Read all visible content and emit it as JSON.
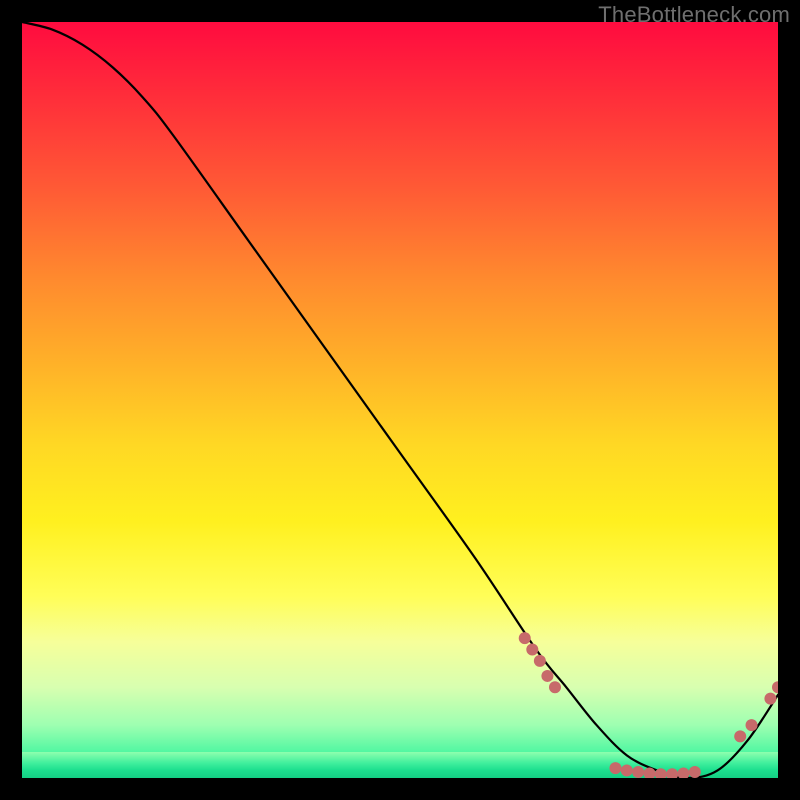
{
  "watermark": "TheBottleneck.com",
  "chart_data": {
    "type": "line",
    "title": "",
    "xlabel": "",
    "ylabel": "",
    "xlim": [
      0,
      100
    ],
    "ylim": [
      0,
      100
    ],
    "grid": false,
    "legend": false,
    "series": [
      {
        "name": "curve",
        "color": "#000000",
        "x": [
          0,
          4,
          8,
          12,
          16,
          20,
          30,
          40,
          50,
          60,
          68,
          72,
          76,
          80,
          84,
          88,
          92,
          96,
          100
        ],
        "values": [
          100,
          99,
          97,
          94,
          90,
          85,
          71,
          57,
          43,
          29,
          17,
          12,
          7,
          3,
          1,
          0,
          1,
          5,
          11
        ]
      }
    ],
    "markers": [
      {
        "x": 66.5,
        "y": 18.5
      },
      {
        "x": 67.5,
        "y": 17.0
      },
      {
        "x": 68.5,
        "y": 15.5
      },
      {
        "x": 69.5,
        "y": 13.5
      },
      {
        "x": 70.5,
        "y": 12.0
      },
      {
        "x": 78.5,
        "y": 1.3
      },
      {
        "x": 80.0,
        "y": 1.0
      },
      {
        "x": 81.5,
        "y": 0.8
      },
      {
        "x": 83.0,
        "y": 0.6
      },
      {
        "x": 84.5,
        "y": 0.5
      },
      {
        "x": 86.0,
        "y": 0.5
      },
      {
        "x": 87.5,
        "y": 0.6
      },
      {
        "x": 89.0,
        "y": 0.8
      },
      {
        "x": 95.0,
        "y": 5.5
      },
      {
        "x": 96.5,
        "y": 7.0
      },
      {
        "x": 99.0,
        "y": 10.5
      },
      {
        "x": 100.0,
        "y": 12.0
      }
    ],
    "marker_color": "#c76a6a",
    "marker_radius": 6
  }
}
